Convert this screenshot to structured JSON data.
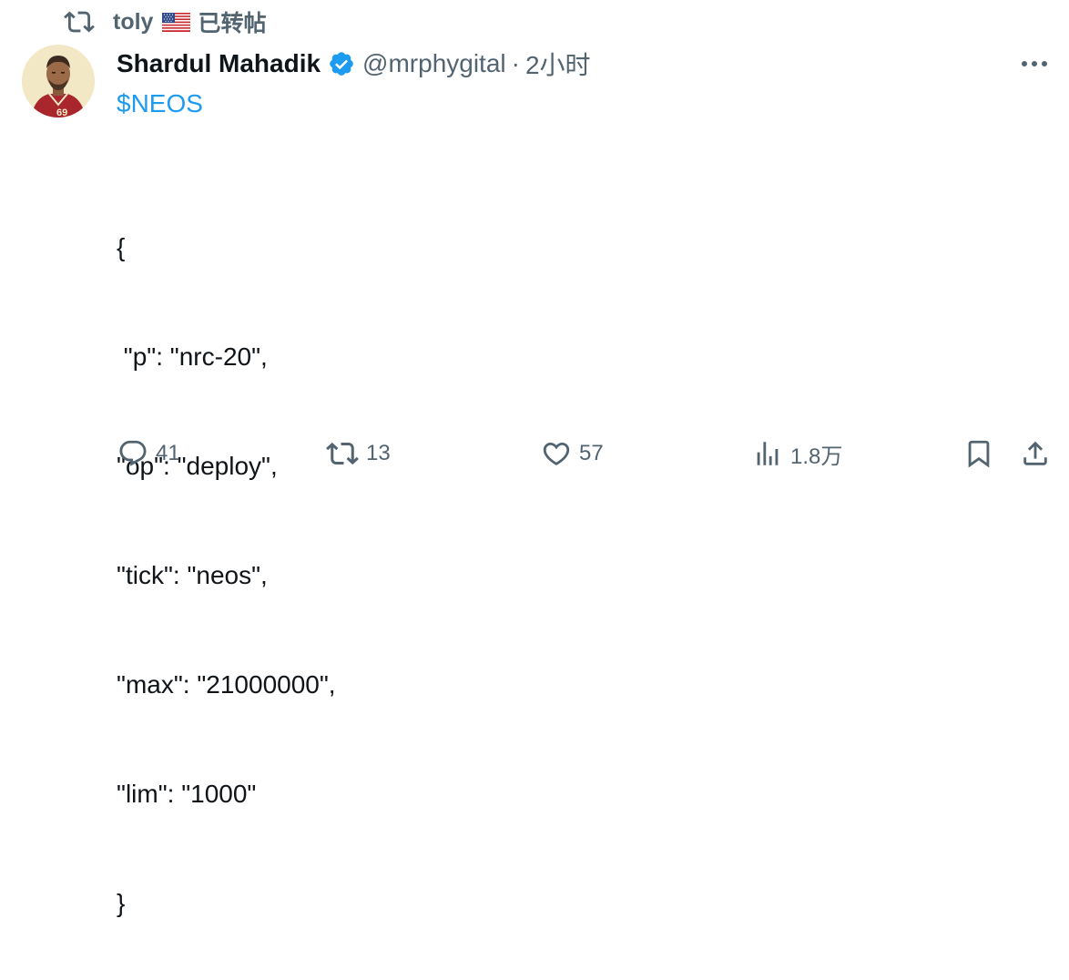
{
  "context": {
    "user": "toly",
    "flag_icon": "us-flag-icon",
    "label": "已转帖"
  },
  "author": {
    "display_name": "Shardul Mahadik",
    "handle": "@mrphygital",
    "separator": "·",
    "time": "2小时",
    "verified_color": "#1d9bf0"
  },
  "content": {
    "cashtag": "$NEOS",
    "code_lines": [
      "{",
      " \"p\": \"nrc-20\",",
      "\"op\": \"deploy\",",
      "\"tick\": \"neos\",",
      "\"max\": \"21000000\",",
      "\"lim\": \"1000\"",
      "}"
    ]
  },
  "actions": {
    "reply_count": "41",
    "repost_count": "13",
    "like_count": "57",
    "views_count": "1.8万"
  },
  "colors": {
    "text": "#0f1419",
    "secondary": "#536471",
    "accent": "#1d9bf0"
  }
}
